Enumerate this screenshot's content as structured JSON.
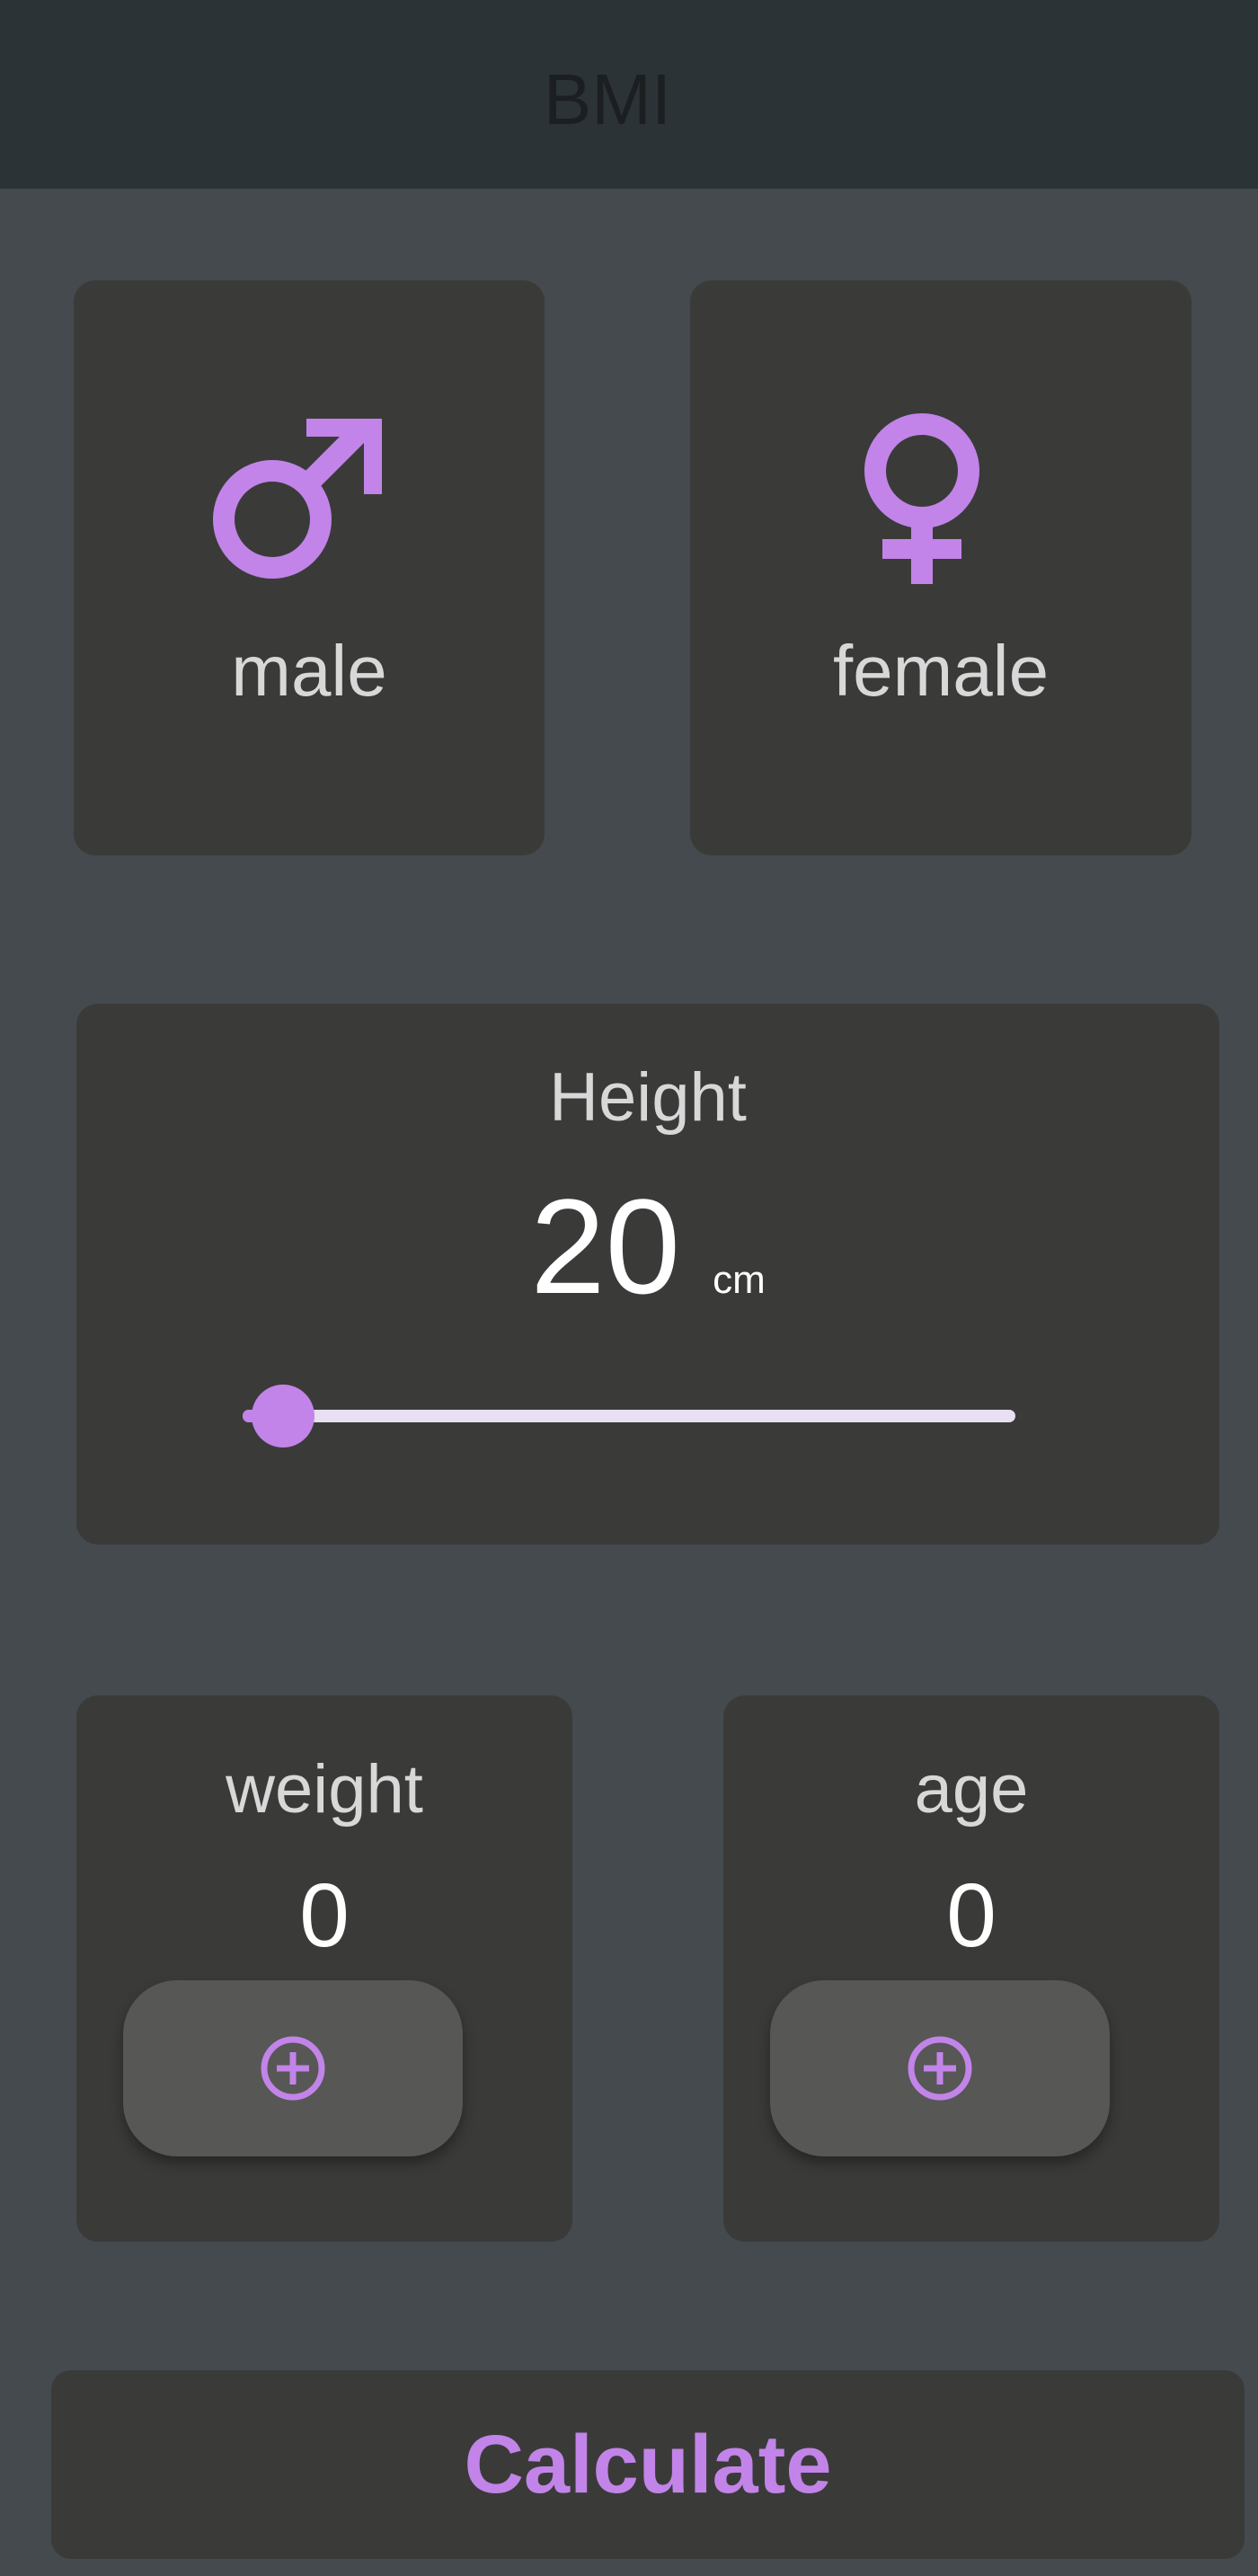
{
  "app_bar": {
    "title": "BMI"
  },
  "gender": {
    "male": {
      "label": "male",
      "icon": "male-symbol-icon"
    },
    "female": {
      "label": "female",
      "icon": "female-symbol-icon"
    }
  },
  "height": {
    "title": "Height",
    "value": "20",
    "unit": "cm",
    "slider_fraction": 0.0
  },
  "weight": {
    "label": "weight",
    "value": "0",
    "button_icon": "add-circle-icon"
  },
  "age": {
    "label": "age",
    "value": "0",
    "button_icon": "add-circle-icon"
  },
  "calculate": {
    "label": "Calculate"
  },
  "colors": {
    "accent": "#c284e8",
    "background": "#444a4d",
    "card": "#3a3b39",
    "app_bar": "#2c3337"
  }
}
